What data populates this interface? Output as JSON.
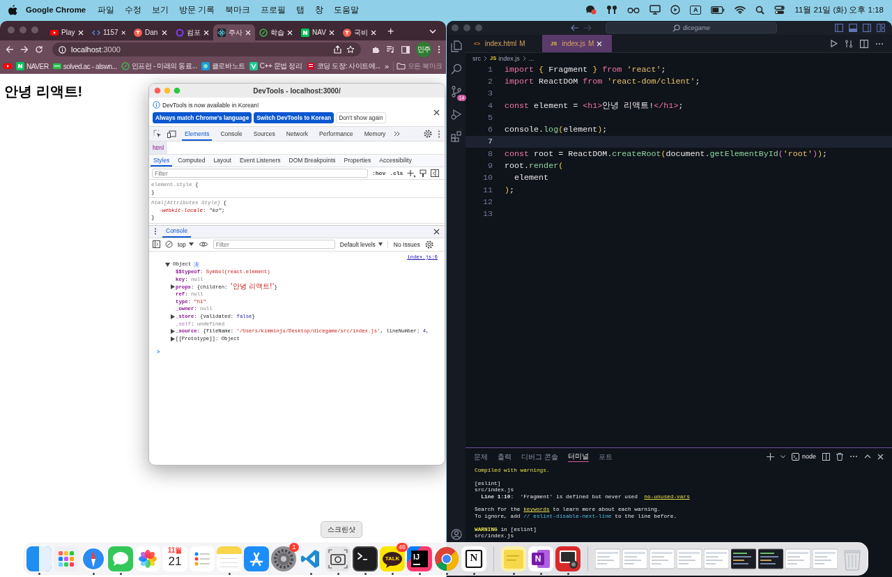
{
  "menubar": {
    "app": "Google Chrome",
    "menus": [
      "파일",
      "수정",
      "보기",
      "방문 기록",
      "북마크",
      "프로필",
      "탭",
      "창",
      "도움말"
    ],
    "input_mode": "A",
    "clock": "11월 21일 (화) 오후 1:18"
  },
  "chrome": {
    "tabs": [
      {
        "title": "Play",
        "kind": "youtube",
        "selected": false
      },
      {
        "title": "1157",
        "kind": "code",
        "selected": false
      },
      {
        "title": "Dan",
        "kind": "red-t",
        "selected": false
      },
      {
        "title": "컴포",
        "kind": "ring",
        "selected": false
      },
      {
        "title": "주사",
        "kind": "react",
        "selected": true
      },
      {
        "title": "학습",
        "kind": "leaf",
        "selected": false
      },
      {
        "title": "NAV",
        "kind": "naver",
        "selected": false
      },
      {
        "title": "국비",
        "kind": "red-t",
        "selected": false
      }
    ],
    "new_tab": "+",
    "url_host": "localhost",
    "url_port": ":3000",
    "profile": "민주",
    "bookmarks": [
      {
        "kind": "youtube"
      },
      {
        "label": "NAVER",
        "kind": "naver"
      },
      {
        "label": "solved.ac - alswn...",
        "kind": "solved"
      },
      {
        "label": "인프런 - 미래의 동료...",
        "kind": "leaf"
      },
      {
        "label": "클로바노트",
        "kind": "clova"
      },
      {
        "label": "C++ 문법 정리",
        "kind": "velog"
      },
      {
        "label": "코딩 도장: 사이트에...",
        "kind": "dojang"
      }
    ],
    "more": "»",
    "all_bookmarks": "모든 북마크",
    "heading": "안녕 리액트!"
  },
  "devtools": {
    "title": "DevTools - localhost:3000/",
    "banner": {
      "message": "DevTools is now available in Korean!",
      "buttons": [
        {
          "label": "Always match Chrome's language",
          "kind": "primary"
        },
        {
          "label": "Switch DevTools to Korean",
          "kind": "primary"
        },
        {
          "label": "Don't show again",
          "kind": "secondary"
        }
      ]
    },
    "tabs": [
      {
        "label": "Elements",
        "selected": true
      },
      {
        "label": "Console",
        "selected": false
      },
      {
        "label": "Sources",
        "selected": false
      },
      {
        "label": "Network",
        "selected": false
      },
      {
        "label": "Performance",
        "selected": false
      },
      {
        "label": "Memory",
        "selected": false
      }
    ],
    "breadcrumb": "html",
    "subtabs": [
      {
        "label": "Styles",
        "selected": true
      },
      {
        "label": "Computed",
        "selected": false
      },
      {
        "label": "Layout",
        "selected": false
      },
      {
        "label": "Event Listeners",
        "selected": false
      },
      {
        "label": "DOM Breakpoints",
        "selected": false
      },
      {
        "label": "Properties",
        "selected": false
      },
      {
        "label": "Accessibility",
        "selected": false
      }
    ],
    "filter_placeholder": "Filter",
    "hov": ":hov",
    "cls": ".cls",
    "rules": [
      {
        "selector": "element.style",
        "kind": "inline",
        "open": "{",
        "close": "}"
      },
      {
        "selector": "html[Attributes Style]",
        "kind": "attributes",
        "open": "{",
        "close": "}",
        "declarations": [
          {
            "property": "-webkit-locale",
            "colon": ":",
            "value": "\"ko\"",
            "semicolon": ";"
          }
        ]
      }
    ],
    "console": {
      "tab": "Console",
      "context": "top",
      "filter_placeholder": "Filter",
      "levels": "Default levels",
      "issues": "No Issues",
      "source": "index.js:6",
      "object": {
        "label": "Object",
        "info": "i",
        "expanded": true,
        "entries": [
          {
            "key": "$$typeof",
            "kind": "own",
            "expandable": false,
            "value": [
              {
                "text": ": ",
                "kind": "p"
              },
              {
                "text": "Symbol(react.element)",
                "kind": "str"
              }
            ]
          },
          {
            "key": "key",
            "kind": "own",
            "expandable": false,
            "value": [
              {
                "text": ": ",
                "kind": "p"
              },
              {
                "text": "null",
                "kind": "null"
              }
            ]
          },
          {
            "key": "props",
            "kind": "own",
            "expandable": true,
            "value": [
              {
                "text": ": {children: ",
                "kind": "p"
              },
              {
                "text": "'안녕 리액트!'",
                "kind": "str"
              },
              {
                "text": "}",
                "kind": "p"
              }
            ]
          },
          {
            "key": "ref",
            "kind": "own",
            "expandable": false,
            "value": [
              {
                "text": ": ",
                "kind": "p"
              },
              {
                "text": "null",
                "kind": "null"
              }
            ]
          },
          {
            "key": "type",
            "kind": "own",
            "expandable": false,
            "value": [
              {
                "text": ": ",
                "kind": "p"
              },
              {
                "text": "\"h1\"",
                "kind": "str"
              }
            ]
          },
          {
            "key": "_owner",
            "kind": "own",
            "expandable": false,
            "value": [
              {
                "text": ": ",
                "kind": "p"
              },
              {
                "text": "null",
                "kind": "null"
              }
            ]
          },
          {
            "key": "_store",
            "kind": "own",
            "expandable": true,
            "value": [
              {
                "text": ": {validated: ",
                "kind": "p"
              },
              {
                "text": "false",
                "kind": "kw"
              },
              {
                "text": "}",
                "kind": "p"
              }
            ]
          },
          {
            "key": "_self",
            "kind": "hidden",
            "expandable": false,
            "value": [
              {
                "text": ": ",
                "kind": "p"
              },
              {
                "text": "undefined",
                "kind": "null"
              }
            ]
          },
          {
            "key": "_source",
            "kind": "own",
            "expandable": true,
            "value": [
              {
                "text": ": {fileName: ",
                "kind": "p"
              },
              {
                "text": "'/Users/kimminju/Desktop/dicegame/src/index.js'",
                "kind": "str"
              },
              {
                "text": ", lineNumber: ",
                "kind": "p"
              },
              {
                "text": "4",
                "kind": "num"
              },
              {
                "text": ",",
                "kind": "p"
              }
            ]
          },
          {
            "key": "[[Prototype]]",
            "kind": "internal",
            "expandable": true,
            "value": [
              {
                "text": ": ",
                "kind": "p"
              },
              {
                "text": "Object",
                "kind": "p"
              }
            ]
          }
        ]
      },
      "prompt": ">"
    }
  },
  "vscode": {
    "search": "dicegame",
    "tabs": [
      {
        "label": "index.html",
        "icon_label": "<>",
        "kind": "html",
        "status": "M",
        "selected": false
      },
      {
        "label": "index.js",
        "icon_label": "JS",
        "kind": "js",
        "status": "M",
        "selected": true
      }
    ],
    "breadcrumb": [
      {
        "label": "src"
      },
      {
        "label": "index.js",
        "icon_label": "JS"
      },
      {
        "label": "..."
      }
    ],
    "scm_badge": "14",
    "lines": [
      {
        "n": "1",
        "current": false,
        "tokens": [
          {
            "text": "import ",
            "kind": "kw"
          },
          {
            "text": "{",
            "kind": "br"
          },
          {
            "text": " Fragment ",
            "kind": "p"
          },
          {
            "text": "}",
            "kind": "br"
          },
          {
            "text": " from ",
            "kind": "kw"
          },
          {
            "text": "'react'",
            "kind": "str"
          },
          {
            "text": ";",
            "kind": "p"
          }
        ]
      },
      {
        "n": "2",
        "current": false,
        "tokens": [
          {
            "text": "import ",
            "kind": "kw"
          },
          {
            "text": "ReactDOM ",
            "kind": "p"
          },
          {
            "text": "from ",
            "kind": "kw"
          },
          {
            "text": "'react-dom/client'",
            "kind": "str"
          },
          {
            "text": ";",
            "kind": "p"
          }
        ]
      },
      {
        "n": "3",
        "current": false
      },
      {
        "n": "4",
        "current": false,
        "tokens": [
          {
            "text": "const ",
            "kind": "kw"
          },
          {
            "text": "element = ",
            "kind": "p"
          },
          {
            "text": "<h1>",
            "kind": "tag"
          },
          {
            "text": "안녕 리액트!",
            "kind": "p"
          },
          {
            "text": "</h1>",
            "kind": "tag"
          },
          {
            "text": ";",
            "kind": "p"
          }
        ]
      },
      {
        "n": "5",
        "current": false
      },
      {
        "n": "6",
        "current": false,
        "tokens": [
          {
            "text": "console.",
            "kind": "p"
          },
          {
            "text": "log",
            "kind": "fn"
          },
          {
            "text": "(",
            "kind": "br"
          },
          {
            "text": "element",
            "kind": "p"
          },
          {
            "text": ")",
            "kind": "br"
          },
          {
            "text": ";",
            "kind": "p"
          }
        ]
      },
      {
        "n": "7",
        "current": true
      },
      {
        "n": "8",
        "current": false,
        "tokens": [
          {
            "text": "const ",
            "kind": "kw"
          },
          {
            "text": "root = ReactDOM.",
            "kind": "p"
          },
          {
            "text": "createRoot",
            "kind": "fn"
          },
          {
            "text": "(",
            "kind": "br"
          },
          {
            "text": "document.",
            "kind": "p"
          },
          {
            "text": "getElementById",
            "kind": "fn"
          },
          {
            "text": "(",
            "kind": "br2"
          },
          {
            "text": "'root'",
            "kind": "str"
          },
          {
            "text": ")",
            "kind": "br2"
          },
          {
            "text": ")",
            "kind": "br"
          },
          {
            "text": ";",
            "kind": "p"
          }
        ]
      },
      {
        "n": "9",
        "current": false,
        "tokens": [
          {
            "text": "root.",
            "kind": "p"
          },
          {
            "text": "render",
            "kind": "fn"
          },
          {
            "text": "(",
            "kind": "br"
          }
        ]
      },
      {
        "n": "10",
        "current": false,
        "tokens": [
          {
            "text": "  element",
            "kind": "p"
          }
        ]
      },
      {
        "n": "11",
        "current": false,
        "tokens": [
          {
            "text": ")",
            "kind": "br"
          },
          {
            "text": ";",
            "kind": "p"
          }
        ]
      },
      {
        "n": "12",
        "current": false
      },
      {
        "n": "13",
        "current": false
      }
    ],
    "panel": {
      "tabs": [
        {
          "label": "문제",
          "selected": false
        },
        {
          "label": "출력",
          "selected": false
        },
        {
          "label": "디버그 콘솔",
          "selected": false
        },
        {
          "label": "터미널",
          "selected": true
        },
        {
          "label": "포트",
          "selected": false
        }
      ],
      "shell": "node",
      "terminal": [
        [
          [
            {
              "text": "Compiled with warnings.",
              "kind": "warn"
            }
          ]
        ],
        [
          [
            {
              "text": "[eslint]",
              "kind": "p"
            }
          ],
          [
            {
              "text": "src/index.js",
              "kind": "p"
            }
          ],
          [
            {
              "text": "  Line 1:10:",
              "kind": "bold"
            },
            {
              "text": "  'Fragment' is defined but never used  ",
              "kind": "p"
            },
            {
              "text": "no-unused-vars",
              "kind": "link"
            }
          ]
        ],
        [
          [
            {
              "text": "Search for the ",
              "kind": "p"
            },
            {
              "text": "keywords",
              "kind": "link"
            },
            {
              "text": " to learn more about each warning.",
              "kind": "p"
            }
          ],
          [
            {
              "text": "To ignore, add ",
              "kind": "p"
            },
            {
              "text": "// eslint-disable-next-line",
              "kind": "cyan"
            },
            {
              "text": " to the line before.",
              "kind": "p"
            }
          ]
        ],
        [
          [
            {
              "text": "WARNING",
              "kind": "boldwarn"
            },
            {
              "text": " in [eslint]",
              "kind": "p"
            }
          ],
          [
            {
              "text": "src/index.js",
              "kind": "p"
            }
          ]
        ]
      ]
    }
  },
  "dock": {
    "tooltip": "스크린샷",
    "items": [
      {
        "kind": "finder",
        "running": true
      },
      {
        "kind": "launchpad",
        "running": false
      },
      {
        "kind": "safari",
        "running": true
      },
      {
        "kind": "messages",
        "running": true
      },
      {
        "kind": "photos",
        "running": false
      },
      {
        "kind": "calendar",
        "running": false,
        "month": "11월",
        "day": "21"
      },
      {
        "kind": "reminders",
        "running": false
      },
      {
        "kind": "notes",
        "running": true
      },
      {
        "kind": "appstore",
        "running": false
      },
      {
        "kind": "settings",
        "running": false,
        "badge": "1"
      },
      {
        "kind": "vscode",
        "running": true
      },
      {
        "kind": "screenshot",
        "running": true
      },
      {
        "kind": "terminal",
        "running": true
      },
      {
        "kind": "kakao",
        "running": true,
        "label": "TALK",
        "badge": "46"
      },
      {
        "kind": "intellij",
        "running": true,
        "label": "IJ"
      },
      {
        "kind": "chrome",
        "running": true
      },
      {
        "kind": "notion",
        "running": true,
        "label": "N"
      },
      {
        "kind": "separator"
      },
      {
        "kind": "stickies",
        "running": true
      },
      {
        "kind": "onenote",
        "running": true,
        "label": "N"
      },
      {
        "kind": "photobooth",
        "running": true
      },
      {
        "kind": "separator"
      },
      {
        "kind": "thumb",
        "running": false
      },
      {
        "kind": "thumb",
        "running": false
      },
      {
        "kind": "thumb",
        "running": false
      },
      {
        "kind": "thumb",
        "running": false
      },
      {
        "kind": "thumb",
        "running": false
      },
      {
        "kind": "thumb-dark",
        "running": false
      },
      {
        "kind": "thumb-dark",
        "running": false
      },
      {
        "kind": "thumb",
        "running": false
      },
      {
        "kind": "thumb",
        "running": false
      },
      {
        "kind": "trash",
        "running": false
      }
    ]
  }
}
